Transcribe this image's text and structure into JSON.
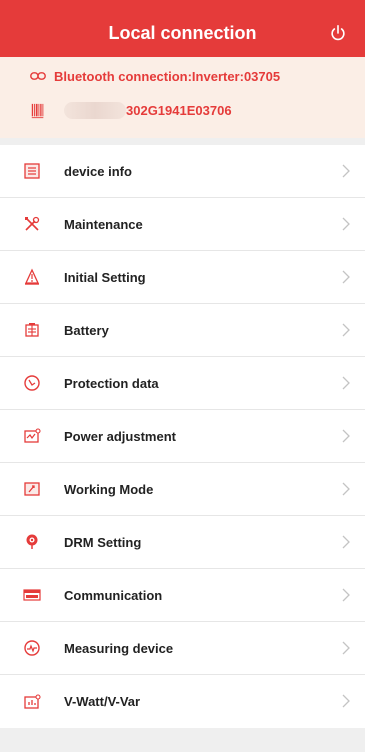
{
  "header": {
    "title": "Local connection",
    "power_icon": "power-icon"
  },
  "connection": {
    "bluetooth_text": "Bluetooth connection:Inverter:03705",
    "serial_text": "302G1941E03706"
  },
  "menu": {
    "items": [
      {
        "label": "device info",
        "icon": "document-icon"
      },
      {
        "label": "Maintenance",
        "icon": "tools-icon"
      },
      {
        "label": "Initial Setting",
        "icon": "settings-icon"
      },
      {
        "label": "Battery",
        "icon": "battery-icon"
      },
      {
        "label": "Protection data",
        "icon": "protection-icon"
      },
      {
        "label": "Power adjustment",
        "icon": "power-adjust-icon"
      },
      {
        "label": "Working Mode",
        "icon": "working-mode-icon"
      },
      {
        "label": "DRM Setting",
        "icon": "drm-icon"
      },
      {
        "label": "Communication",
        "icon": "communication-icon"
      },
      {
        "label": "Measuring device",
        "icon": "measuring-icon"
      },
      {
        "label": "V-Watt/V-Var",
        "icon": "chart-icon"
      }
    ]
  },
  "colors": {
    "accent": "#e53b3a",
    "panel": "#fbeee6",
    "background": "#efefef"
  }
}
